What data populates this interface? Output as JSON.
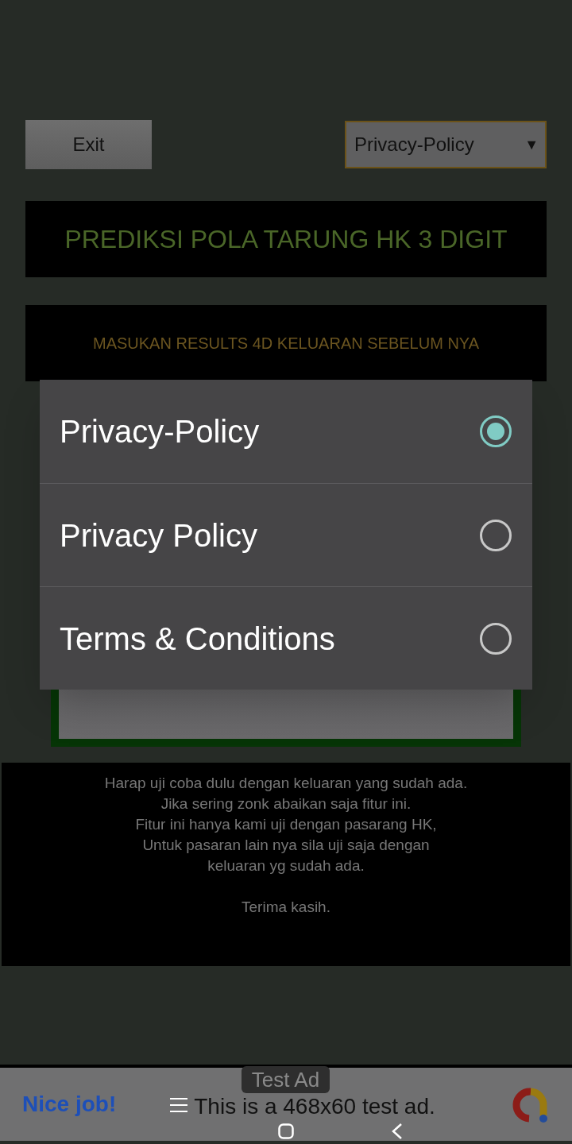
{
  "header": {
    "exit_button": "Exit",
    "dropdown": {
      "value": "Privacy-Policy",
      "arrow": "▼"
    }
  },
  "title": "PREDIKSI POLA TARUNG HK 3 DIGIT",
  "instruction": "MASUKAN RESULTS 4D KELUARAN SEBELUM NYA",
  "notes": {
    "lines": [
      "Harap uji coba dulu dengan keluaran yang sudah ada.",
      "Jika sering zonk abaikan saja fitur ini.",
      "Fitur ini hanya kami uji dengan pasarang HK,",
      "Untuk pasaran lain nya sila uji saja dengan",
      "keluaran yg sudah ada."
    ],
    "closing": "Terima kasih."
  },
  "ad": {
    "label": "Test Ad",
    "headline": "Nice job!",
    "text": "This is a 468x60 test ad."
  },
  "dialog": {
    "options": [
      {
        "label": "Privacy-Policy",
        "selected": true
      },
      {
        "label": "Privacy Policy",
        "selected": false
      },
      {
        "label": "Terms & Conditions",
        "selected": false
      }
    ]
  }
}
